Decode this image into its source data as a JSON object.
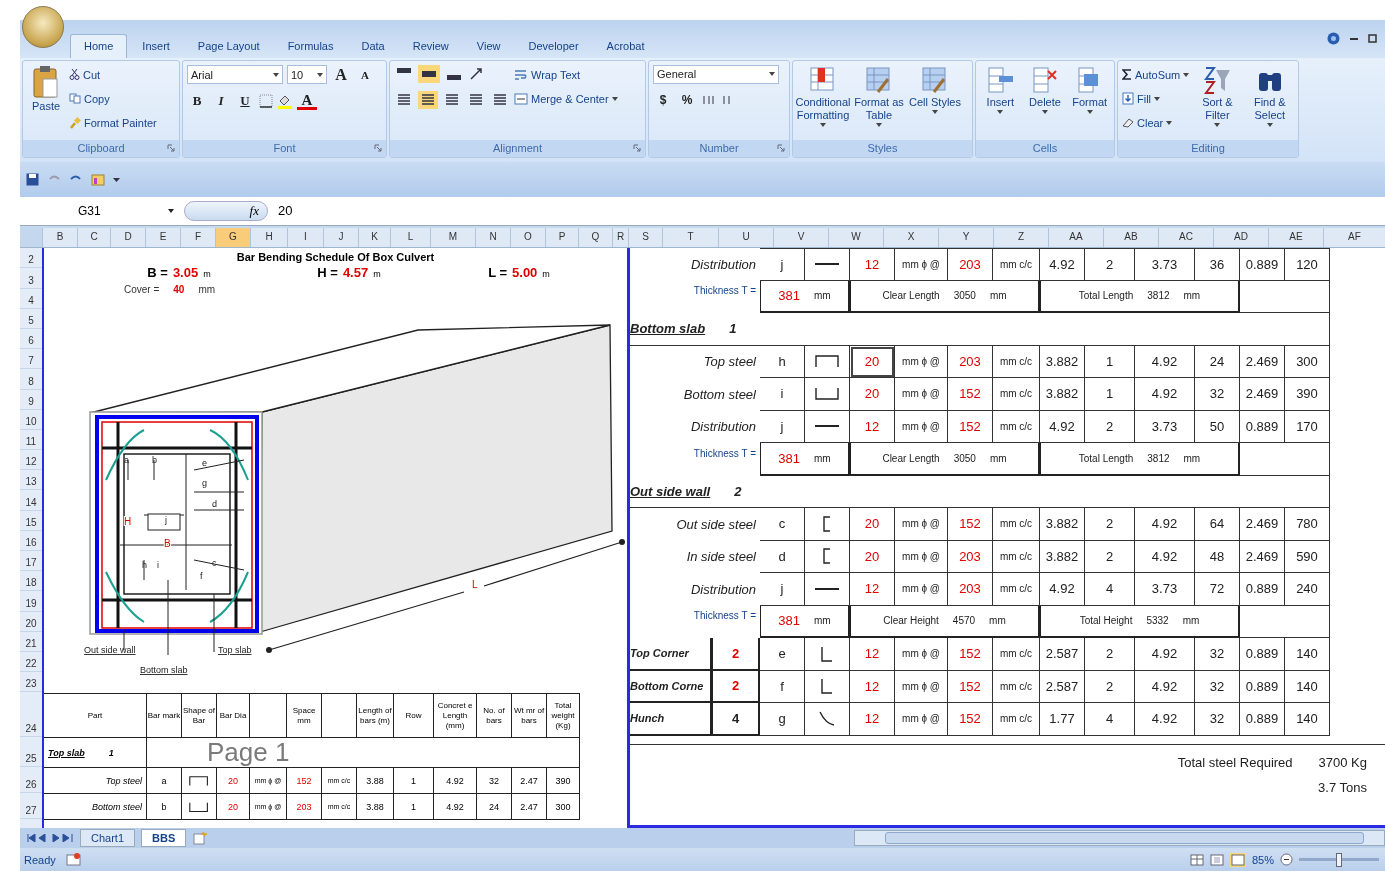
{
  "ribbon": {
    "tabs": [
      {
        "label": "Home",
        "selected": true
      },
      {
        "label": "Insert",
        "selected": false
      },
      {
        "label": "Page Layout",
        "selected": false
      },
      {
        "label": "Formulas",
        "selected": false
      },
      {
        "label": "Data",
        "selected": false
      },
      {
        "label": "Review",
        "selected": false
      },
      {
        "label": "View",
        "selected": false
      },
      {
        "label": "Developer",
        "selected": false
      },
      {
        "label": "Acrobat",
        "selected": false
      }
    ],
    "clipboard": {
      "name": "Clipboard",
      "paste": "Paste",
      "items": [
        "Cut",
        "Copy",
        "Format Painter"
      ]
    },
    "font": {
      "name": "Font",
      "family": "Arial",
      "size": "10",
      "grow": "A",
      "shrink": "A",
      "styles": [
        "B",
        "I",
        "U"
      ],
      "color_glyph": "A"
    },
    "alignment": {
      "name": "Alignment",
      "wrap": "Wrap Text",
      "merge": "Merge & Center"
    },
    "number": {
      "name": "Number",
      "format": "General",
      "symbols": [
        "$",
        "%"
      ]
    },
    "styles": {
      "name": "Styles",
      "buttons": [
        "Conditional Formatting",
        "Format as Table",
        "Cell Styles"
      ]
    },
    "cells": {
      "name": "Cells",
      "buttons": [
        "Insert",
        "Delete",
        "Format"
      ]
    },
    "editing": {
      "name": "Editing",
      "items": [
        "AutoSum",
        "Fill",
        "Clear"
      ],
      "buttons": [
        "Sort & Filter",
        "Find & Select"
      ]
    }
  },
  "formula_bar": {
    "name_box": "G31",
    "fx": "fx",
    "value": "20"
  },
  "columns": [
    {
      "label": "B",
      "selected": false
    },
    {
      "label": "C",
      "selected": false
    },
    {
      "label": "D",
      "selected": false
    },
    {
      "label": "E",
      "selected": false
    },
    {
      "label": "F",
      "selected": false
    },
    {
      "label": "G",
      "selected": true
    },
    {
      "label": "H",
      "selected": false
    },
    {
      "label": "I",
      "selected": false
    },
    {
      "label": "J",
      "selected": false
    },
    {
      "label": "K",
      "selected": false
    },
    {
      "label": "L",
      "selected": false
    },
    {
      "label": "M",
      "selected": false
    },
    {
      "label": "N",
      "selected": false
    },
    {
      "label": "O",
      "selected": false
    },
    {
      "label": "P",
      "selected": false
    },
    {
      "label": "Q",
      "selected": false
    },
    {
      "label": "R",
      "selected": false
    },
    {
      "label": "S",
      "selected": false
    },
    {
      "label": "T",
      "selected": false
    },
    {
      "label": "U",
      "selected": false
    },
    {
      "label": "V",
      "selected": false
    },
    {
      "label": "W",
      "selected": false
    },
    {
      "label": "X",
      "selected": false
    },
    {
      "label": "Y",
      "selected": false
    },
    {
      "label": "Z",
      "selected": false
    },
    {
      "label": "AA",
      "selected": false
    },
    {
      "label": "AB",
      "selected": false
    },
    {
      "label": "AC",
      "selected": false
    },
    {
      "label": "AD",
      "selected": false
    },
    {
      "label": "AE",
      "selected": false
    },
    {
      "label": "AF",
      "selected": false
    }
  ],
  "rows": [
    "2",
    "3",
    "4",
    "5",
    "6",
    "7",
    "8",
    "9",
    "10",
    "11",
    "12",
    "13",
    "14",
    "15",
    "16",
    "17",
    "18",
    "19",
    "20",
    "21",
    "22",
    "23",
    "24",
    "25",
    "26",
    "27"
  ],
  "sheet": {
    "title": "Bar Bending Schedule Of Box Culvert",
    "params": [
      {
        "label": "B =",
        "value": "3.05",
        "unit": "m"
      },
      {
        "label": "H =",
        "value": "4.57",
        "unit": "m"
      },
      {
        "label": "L =",
        "value": "5.00",
        "unit": "m"
      }
    ],
    "cover": {
      "label": "Cover =",
      "value": "40",
      "unit": "mm"
    },
    "drawing_labels": [
      {
        "text": "a",
        "kind": "mark"
      },
      {
        "text": "b",
        "kind": "mark"
      },
      {
        "text": "e",
        "kind": "mark"
      },
      {
        "text": "g",
        "kind": "mark"
      },
      {
        "text": "d",
        "kind": "mark"
      },
      {
        "text": "H",
        "kind": "dimension"
      },
      {
        "text": "j",
        "kind": "mark"
      },
      {
        "text": "B",
        "kind": "dimension"
      },
      {
        "text": "h",
        "kind": "mark"
      },
      {
        "text": "i",
        "kind": "mark"
      },
      {
        "text": "c",
        "kind": "mark"
      },
      {
        "text": "f",
        "kind": "mark"
      },
      {
        "text": "L",
        "kind": "dimension"
      }
    ],
    "callouts": [
      "Out side wall",
      "Top slab",
      "Bottom slab"
    ],
    "page_label": "Page 1",
    "left_table": {
      "headers": [
        "Part",
        "Bar mark",
        "Shape of Bar",
        "Bar Dia",
        "Space mm",
        "Length of bars (m)",
        "Row",
        "Concret e Length (mm)",
        "No. of bars",
        "Wt mr of bars",
        "Total weight (Kg)"
      ],
      "rows": [
        {
          "kind": "section",
          "part": "Top slab",
          "count": "1"
        },
        {
          "kind": "bar",
          "part": "Top steel",
          "mark": "a",
          "shape": {
            "kind": "top-hook"
          },
          "dia": "20",
          "unit": "mm ɸ @",
          "spacing": "152",
          "spacing_unit": "mm c/c",
          "length": "3.88",
          "row": "1",
          "concrete_length": "4.92",
          "bars": "32",
          "unit_weight": "2.47",
          "weight": "390"
        },
        {
          "kind": "bar",
          "part": "Bottom steel",
          "mark": "b",
          "shape": {
            "kind": "bottom-hook"
          },
          "dia": "20",
          "unit": "mm ɸ @",
          "spacing": "203",
          "spacing_unit": "mm c/c",
          "length": "3.88",
          "row": "1",
          "concrete_length": "4.92",
          "bars": "24",
          "unit_weight": "2.47",
          "weight": "300"
        }
      ]
    },
    "right_table": [
      {
        "kind": "bar",
        "part": "Distribution",
        "mark": "j",
        "shape": {
          "kind": "line"
        },
        "dia": "12",
        "unit": "mm ɸ @",
        "spacing": "203",
        "spacing_unit": "mm c/c",
        "length": "4.92",
        "row": "2",
        "concrete_length": "3.73",
        "bars": "36",
        "unit_weight": "0.889",
        "weight": "120",
        "selected": false
      },
      {
        "kind": "thickness",
        "label": "Thickness T =",
        "value": "381",
        "unit": "mm",
        "clear_label": "Clear Length",
        "clear_value": "3050",
        "clear_unit": "mm",
        "total_label": "Total Length",
        "total_value": "3812",
        "total_unit": "mm"
      },
      {
        "kind": "section",
        "part": "Bottom slab",
        "count": "1"
      },
      {
        "kind": "bar",
        "part": "Top steel",
        "mark": "h",
        "shape": {
          "kind": "top-hook"
        },
        "dia": "20",
        "unit": "mm ɸ @",
        "spacing": "203",
        "spacing_unit": "mm c/c",
        "length": "3.882",
        "row": "1",
        "concrete_length": "4.92",
        "bars": "24",
        "unit_weight": "2.469",
        "weight": "300",
        "selected": true
      },
      {
        "kind": "bar",
        "part": "Bottom steel",
        "mark": "i",
        "shape": {
          "kind": "bottom-hook"
        },
        "dia": "20",
        "unit": "mm ɸ @",
        "spacing": "152",
        "spacing_unit": "mm c/c",
        "length": "3.882",
        "row": "1",
        "concrete_length": "4.92",
        "bars": "32",
        "unit_weight": "2.469",
        "weight": "390",
        "selected": false
      },
      {
        "kind": "bar",
        "part": "Distribution",
        "mark": "j",
        "shape": {
          "kind": "line"
        },
        "dia": "12",
        "unit": "mm ɸ @",
        "spacing": "152",
        "spacing_unit": "mm c/c",
        "length": "4.92",
        "row": "2",
        "concrete_length": "3.73",
        "bars": "50",
        "unit_weight": "0.889",
        "weight": "170",
        "selected": false
      },
      {
        "kind": "thickness",
        "label": "Thickness T =",
        "value": "381",
        "unit": "mm",
        "clear_label": "Clear Length",
        "clear_value": "3050",
        "clear_unit": "mm",
        "total_label": "Total Length",
        "total_value": "3812",
        "total_unit": "mm"
      },
      {
        "kind": "section",
        "part": "Out side wall",
        "count": "2"
      },
      {
        "kind": "bar",
        "part": "Out side steel",
        "mark": "c",
        "shape": {
          "kind": "bracket"
        },
        "dia": "20",
        "unit": "mm ɸ @",
        "spacing": "152",
        "spacing_unit": "mm c/c",
        "length": "3.882",
        "row": "2",
        "concrete_length": "4.92",
        "bars": "64",
        "unit_weight": "2.469",
        "weight": "780",
        "selected": false
      },
      {
        "kind": "bar",
        "part": "In side steel",
        "mark": "d",
        "shape": {
          "kind": "bracket"
        },
        "dia": "20",
        "unit": "mm ɸ @",
        "spacing": "203",
        "spacing_unit": "mm c/c",
        "length": "3.882",
        "row": "2",
        "concrete_length": "4.92",
        "bars": "48",
        "unit_weight": "2.469",
        "weight": "590",
        "selected": false
      },
      {
        "kind": "bar",
        "part": "Distribution",
        "mark": "j",
        "shape": {
          "kind": "line"
        },
        "dia": "12",
        "unit": "mm ɸ @",
        "spacing": "203",
        "spacing_unit": "mm c/c",
        "length": "4.92",
        "row": "4",
        "concrete_length": "3.73",
        "bars": "72",
        "unit_weight": "0.889",
        "weight": "240",
        "selected": false
      },
      {
        "kind": "thickness",
        "label": "Thickness T =",
        "value": "381",
        "unit": "mm",
        "clear_label": "Clear Height",
        "clear_value": "4570",
        "clear_unit": "mm",
        "total_label": "Total Height",
        "total_value": "5332",
        "total_unit": "mm"
      },
      {
        "kind": "corner",
        "part": "Top Corner",
        "count": "2",
        "count_input": true,
        "mark": "e",
        "shape": {
          "kind": "angle"
        },
        "dia": "12",
        "unit": "mm ɸ @",
        "spacing": "152",
        "spacing_unit": "mm c/c",
        "length": "2.587",
        "row": "2",
        "concrete_length": "4.92",
        "bars": "32",
        "unit_weight": "0.889",
        "weight": "140"
      },
      {
        "kind": "corner",
        "part": "Bottom Corne",
        "count": "2",
        "count_input": true,
        "mark": "f",
        "shape": {
          "kind": "angle"
        },
        "dia": "12",
        "unit": "mm ɸ @",
        "spacing": "152",
        "spacing_unit": "mm c/c",
        "length": "2.587",
        "row": "2",
        "concrete_length": "4.92",
        "bars": "32",
        "unit_weight": "0.889",
        "weight": "140"
      },
      {
        "kind": "corner",
        "part": "Hunch",
        "count": "4",
        "count_input": false,
        "mark": "g",
        "shape": {
          "kind": "hunch"
        },
        "dia": "12",
        "unit": "mm ɸ @",
        "spacing": "152",
        "spacing_unit": "mm c/c",
        "length": "1.77",
        "row": "4",
        "concrete_length": "4.92",
        "bars": "32",
        "unit_weight": "0.889",
        "weight": "140"
      }
    ],
    "total": {
      "label": "Total steel Required",
      "kg": "3700 Kg",
      "tons": "3.7 Tons"
    }
  },
  "sheet_tabs": [
    {
      "label": "Chart1",
      "selected": false
    },
    {
      "label": "BBS",
      "selected": true
    }
  ],
  "status": {
    "text": "Ready",
    "zoom": "85%",
    "zoom_slider": {
      "level": 0.5
    }
  }
}
